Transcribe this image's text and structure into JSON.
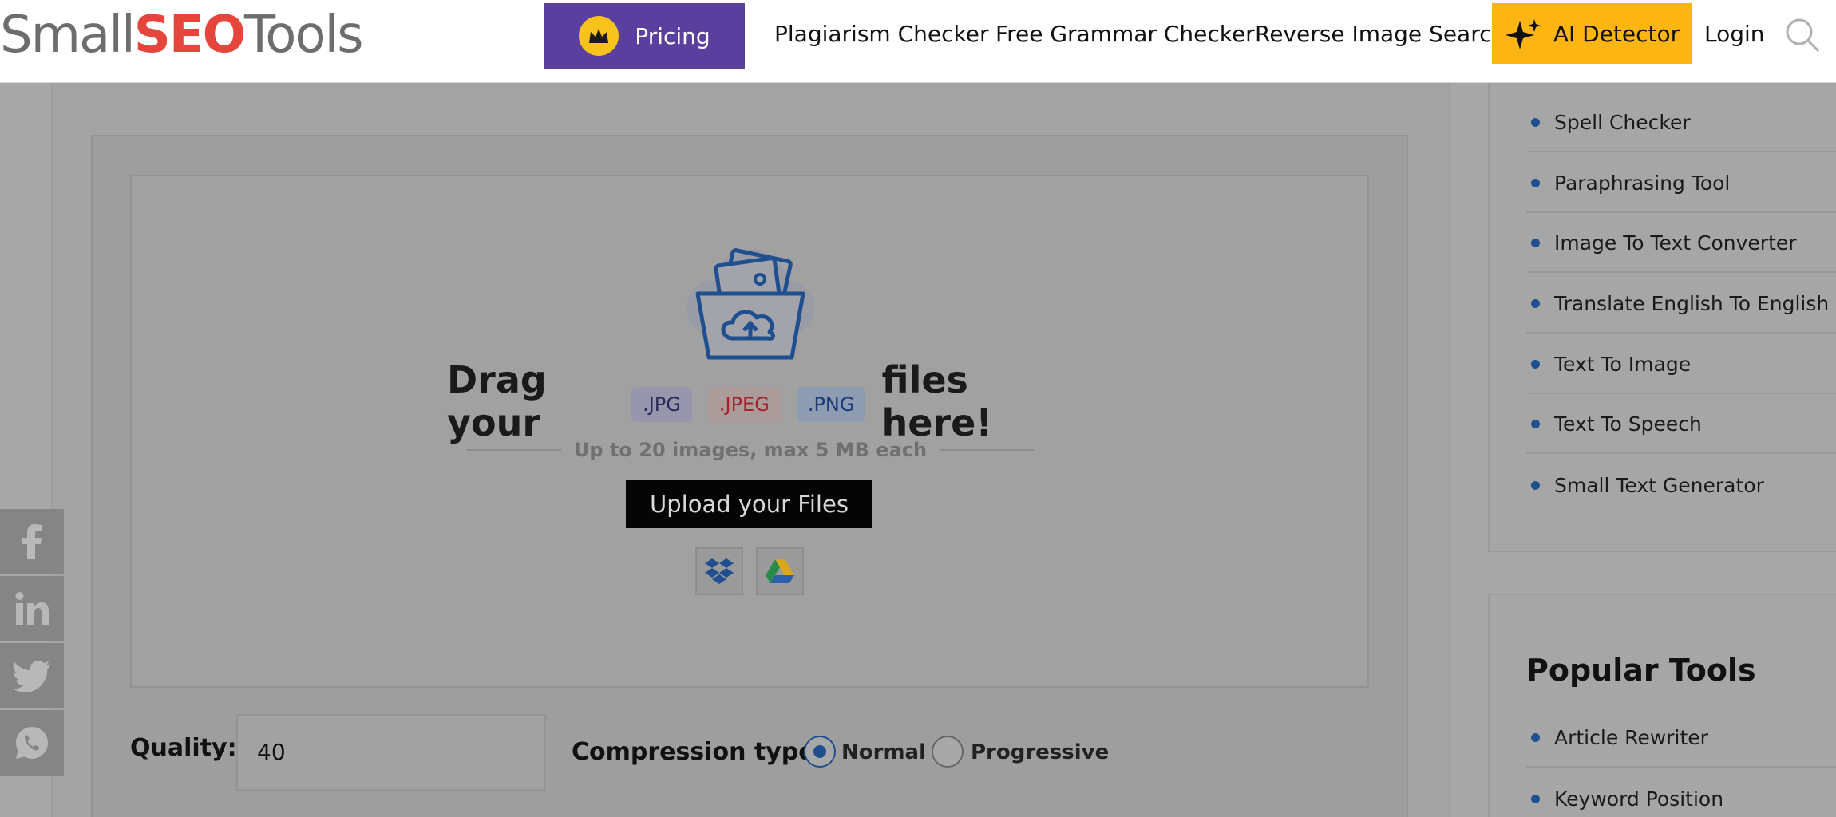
{
  "header": {
    "logo": {
      "part1": "Small",
      "part2": "SEO",
      "part3": "Tools"
    },
    "pricing_label": "Pricing",
    "nav": [
      "Plagiarism Checker",
      "Free Grammar Checker",
      "Reverse Image Search"
    ],
    "ai_detector_label": "AI Detector",
    "login_label": "Login"
  },
  "upload": {
    "drag_prefix": "Drag your",
    "drag_suffix": "files here!",
    "badges": [
      ".JPG",
      ".JPEG",
      ".PNG"
    ],
    "limits": "Up to 20 images, max 5 MB each",
    "button_label": "Upload your Files"
  },
  "options": {
    "quality_label": "Quality:",
    "quality_value": "40",
    "compression_label": "Compression type:",
    "radio_normal": "Normal",
    "radio_progressive": "Progressive",
    "selected": "Normal"
  },
  "sidebar": {
    "items": [
      "Spell Checker",
      "Paraphrasing Tool",
      "Image To Text Converter",
      "Translate English To English",
      "Text To Image",
      "Text To Speech",
      "Small Text Generator"
    ],
    "popular_title": "Popular Tools",
    "popular_items": [
      "Article Rewriter",
      "Keyword Position"
    ]
  },
  "colors": {
    "pricing": "#5b3f9e",
    "ai_detector": "#fdb514",
    "accent_blue": "#1f4f8f"
  }
}
